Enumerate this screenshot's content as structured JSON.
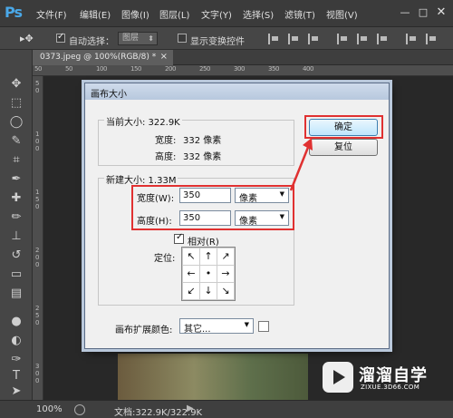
{
  "app": {
    "logo": "Ps",
    "menu": [
      "文件(F)",
      "编辑(E)",
      "图像(I)",
      "图层(L)",
      "文字(Y)",
      "选择(S)",
      "滤镜(T)",
      "视图(V)"
    ],
    "window_buttons": [
      "—",
      "□",
      "✕"
    ]
  },
  "options_bar": {
    "auto_select_checked": true,
    "auto_select_label": "自动选择：",
    "auto_select_target": "图层",
    "show_transform_checked": false,
    "show_transform_label": "显示变换控件"
  },
  "document_tab": {
    "label": "0373.jpeg @ 100%(RGB/8) *",
    "close": "×"
  },
  "ruler": {
    "top": [
      "5",
      "0",
      "5",
      "0",
      "1",
      "0",
      "0",
      "1",
      "5",
      "0",
      "2",
      "0",
      "0",
      "2",
      "5",
      "0",
      "3",
      "0",
      "0",
      "3",
      "5",
      "0",
      "4",
      "0",
      "0"
    ],
    "left": [
      "5",
      "0",
      "1",
      "0",
      "0",
      "1",
      "5",
      "0",
      "2",
      "0",
      "0",
      "2",
      "5",
      "0",
      "3",
      "0",
      "0"
    ]
  },
  "status_bar": {
    "zoom": "100%",
    "doc_info": "文档:322.9K/322.9K",
    "arrow": "▶"
  },
  "dialog": {
    "title": "画布大小",
    "current_size": {
      "group_label": "当前大小: 322.9K",
      "width_label": "宽度:",
      "width_value": "332 像素",
      "height_label": "高度:",
      "height_value": "332 像素"
    },
    "new_size": {
      "group_label": "新建大小: 1.33M",
      "width_label": "宽度(W):",
      "width_value": "350",
      "width_unit": "像素",
      "height_label": "高度(H):",
      "height_value": "350",
      "height_unit": "像素",
      "relative_checked": true,
      "relative_label": "相对(R)",
      "anchor_label": "定位:",
      "anchor_arrows": [
        "↖",
        "↑",
        "↗",
        "←",
        "•",
        "→",
        "↙",
        "↓",
        "↘"
      ]
    },
    "extension_color_label": "画布扩展颜色:",
    "extension_color_value": "其它...",
    "extension_color_swatch": "#ffffff",
    "ok_label": "确定",
    "reset_label": "复位"
  },
  "watermark": {
    "title": "溜溜自学",
    "subtitle": "ZIXUE.3D66.COM"
  },
  "colors": {
    "highlight": "#e03131",
    "photoshop_blue": "#4aa8e8"
  }
}
